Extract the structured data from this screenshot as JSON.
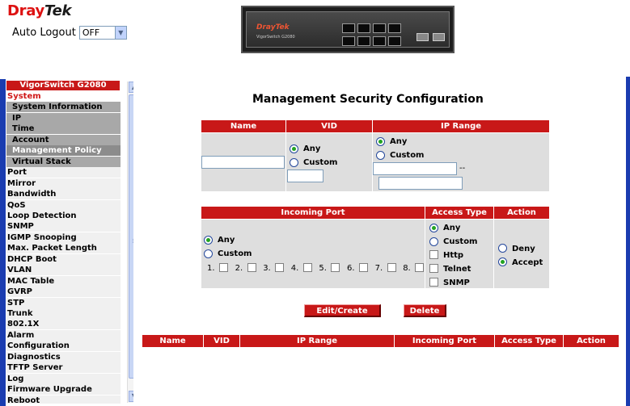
{
  "header": {
    "logo_part1": "Dray",
    "logo_part2": "Tek",
    "auto_logout_label": "Auto Logout",
    "auto_logout_value": "OFF",
    "device_brand": "DrayTek",
    "device_model": "VigorSwitch G2080"
  },
  "menu": {
    "title": "VigorSwitch G2080",
    "items": [
      {
        "label": "System",
        "kind": "active"
      },
      {
        "label": "System Information",
        "kind": "sub"
      },
      {
        "label": "IP",
        "kind": "sub"
      },
      {
        "label": "Time",
        "kind": "sub"
      },
      {
        "label": "Account",
        "kind": "sub"
      },
      {
        "label": "Management Policy",
        "kind": "sub-selected"
      },
      {
        "label": "Virtual Stack",
        "kind": "sub"
      },
      {
        "label": "Port",
        "kind": "cat"
      },
      {
        "label": "Mirror",
        "kind": "cat"
      },
      {
        "label": "Bandwidth",
        "kind": "cat"
      },
      {
        "label": "QoS",
        "kind": "cat"
      },
      {
        "label": "Loop Detection",
        "kind": "cat"
      },
      {
        "label": "SNMP",
        "kind": "cat"
      },
      {
        "label": "IGMP Snooping",
        "kind": "cat"
      },
      {
        "label": "Max. Packet Length",
        "kind": "cat"
      },
      {
        "label": "DHCP Boot",
        "kind": "cat"
      },
      {
        "label": "VLAN",
        "kind": "cat"
      },
      {
        "label": "MAC Table",
        "kind": "cat"
      },
      {
        "label": "GVRP",
        "kind": "cat"
      },
      {
        "label": "STP",
        "kind": "cat"
      },
      {
        "label": "Trunk",
        "kind": "cat"
      },
      {
        "label": "802.1X",
        "kind": "cat"
      },
      {
        "label": "Alarm",
        "kind": "cat"
      },
      {
        "label": "Configuration",
        "kind": "cat"
      },
      {
        "label": "Diagnostics",
        "kind": "cat"
      },
      {
        "label": "TFTP Server",
        "kind": "cat"
      },
      {
        "label": "Log",
        "kind": "cat"
      },
      {
        "label": "Firmware Upgrade",
        "kind": "cat"
      },
      {
        "label": "Reboot",
        "kind": "cat"
      }
    ]
  },
  "main": {
    "title": "Management Security Configuration",
    "table1": {
      "headers": [
        "Name",
        "VID",
        "IP Range"
      ],
      "name_value": "",
      "vid_options": [
        {
          "label": "Any",
          "checked": true
        },
        {
          "label": "Custom",
          "checked": false
        }
      ],
      "vid_value": "",
      "ip_options": [
        {
          "label": "Any",
          "checked": true
        },
        {
          "label": "Custom",
          "checked": false
        }
      ],
      "ip_from": "",
      "ip_sep": "--",
      "ip_to": ""
    },
    "table2": {
      "headers": [
        "Incoming Port",
        "Access Type",
        "Action"
      ],
      "port_options": [
        {
          "label": "Any",
          "checked": true
        },
        {
          "label": "Custom",
          "checked": false
        }
      ],
      "ports": [
        "1.",
        "2.",
        "3.",
        "4.",
        "5.",
        "6.",
        "7.",
        "8."
      ],
      "access_options": [
        {
          "label": "Any",
          "checked": true
        },
        {
          "label": "Custom",
          "checked": false
        }
      ],
      "access_checks": [
        "Http",
        "Telnet",
        "SNMP"
      ],
      "action_options": [
        {
          "label": "Deny",
          "checked": false
        },
        {
          "label": "Accept",
          "checked": true
        }
      ]
    },
    "buttons": {
      "edit": "Edit/Create",
      "delete": "Delete"
    },
    "list_headers": [
      "Name",
      "VID",
      "IP Range",
      "Incoming Port",
      "Access Type",
      "Action"
    ]
  }
}
